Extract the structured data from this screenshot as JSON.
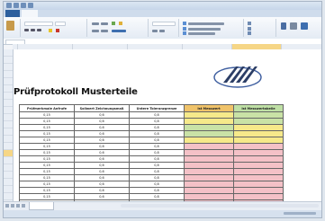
{
  "document": {
    "title": "Prüfprotokoll Musterteile"
  },
  "colors": {
    "ribbon_accent": "#2c5f9e",
    "cell_yellow": "#f6e98a",
    "cell_green": "#c9e2a6",
    "cell_red": "#f4c1c7",
    "header_orange": "#f0c36a",
    "header_green": "#bfe0a5",
    "selected_header": "#f6d686"
  },
  "table": {
    "columns": [
      "Prüfmerkmale Anfrufe",
      "Sollwert Zeichnungsmaß",
      "Untere Toleranzgrenze",
      "Ist Messwert",
      "Ist Messwertabelle"
    ],
    "rows": [
      {
        "cells": [
          "0,15",
          "0,6",
          "0,8",
          "",
          ""
        ],
        "status": [
          "",
          "",
          "",
          "yellow",
          "green"
        ]
      },
      {
        "cells": [
          "0,15",
          "0,6",
          "0,8",
          "",
          ""
        ],
        "status": [
          "",
          "",
          "",
          "yellow",
          "green"
        ]
      },
      {
        "cells": [
          "0,15",
          "0,6",
          "0,8",
          "",
          ""
        ],
        "status": [
          "",
          "",
          "",
          "green",
          "yellow"
        ]
      },
      {
        "cells": [
          "0,15",
          "0,6",
          "0,8",
          "",
          ""
        ],
        "status": [
          "",
          "",
          "",
          "green",
          "yellow"
        ]
      },
      {
        "cells": [
          "0,15",
          "0,6",
          "0,8",
          "",
          ""
        ],
        "status": [
          "",
          "",
          "",
          "yellow",
          "yellow"
        ]
      },
      {
        "cells": [
          "0,15",
          "0,6",
          "0,8",
          "",
          ""
        ],
        "status": [
          "",
          "",
          "",
          "red",
          "red"
        ]
      },
      {
        "cells": [
          "0,15",
          "0,6",
          "0,8",
          "",
          ""
        ],
        "status": [
          "",
          "",
          "",
          "red",
          "red"
        ]
      },
      {
        "cells": [
          "0,15",
          "0,6",
          "0,8",
          "",
          ""
        ],
        "status": [
          "",
          "",
          "",
          "red",
          "red"
        ]
      },
      {
        "cells": [
          "0,15",
          "0,6",
          "0,8",
          "",
          ""
        ],
        "status": [
          "",
          "",
          "",
          "red",
          "red"
        ]
      },
      {
        "cells": [
          "0,15",
          "0,6",
          "0,8",
          "",
          ""
        ],
        "status": [
          "",
          "",
          "",
          "red",
          "red"
        ]
      },
      {
        "cells": [
          "0,15",
          "0,6",
          "0,8",
          "",
          ""
        ],
        "status": [
          "",
          "",
          "",
          "red",
          "red"
        ]
      },
      {
        "cells": [
          "0,15",
          "0,6",
          "0,8",
          "",
          ""
        ],
        "status": [
          "",
          "",
          "",
          "red",
          "red"
        ]
      },
      {
        "cells": [
          "0,15",
          "0,6",
          "0,8",
          "",
          ""
        ],
        "status": [
          "",
          "",
          "",
          "red",
          "red"
        ]
      },
      {
        "cells": [
          "0,15",
          "0,6",
          "0,8",
          "",
          ""
        ],
        "status": [
          "",
          "",
          "",
          "red",
          "red"
        ]
      },
      {
        "cells": [
          "0,15",
          "0,6",
          "0,8",
          "",
          ""
        ],
        "status": [
          "",
          "",
          "",
          "red",
          "red"
        ]
      },
      {
        "cells": [
          "0,15",
          "0,6",
          "0,8",
          "",
          ""
        ],
        "status": [
          "",
          "",
          "",
          "red",
          "red"
        ]
      }
    ]
  },
  "icons": {
    "logo": "swoosh-logo-icon",
    "paste": "paste-icon"
  }
}
